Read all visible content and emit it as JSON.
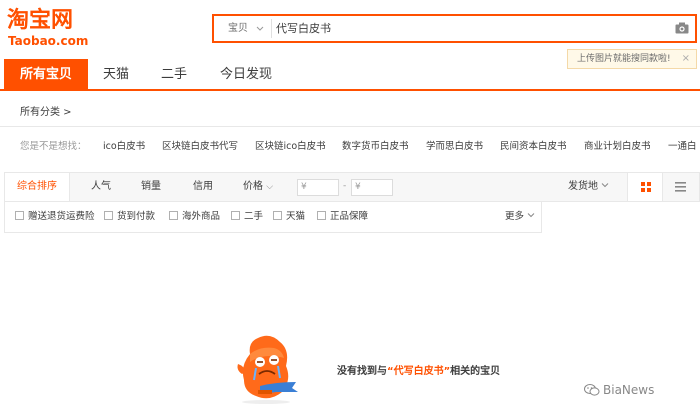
{
  "header": {
    "logo_cn": "淘宝网",
    "logo_en": "Taobao.com",
    "search": {
      "scope": "宝贝",
      "query": "代写白皮书"
    },
    "tip": "上传图片就能搜同款啦!",
    "tip_close": "×"
  },
  "nav": {
    "tabs": [
      {
        "label": "所有宝贝",
        "active": true
      },
      {
        "label": "天猫"
      },
      {
        "label": "二手"
      },
      {
        "label": "今日发现"
      }
    ]
  },
  "category": "所有分类 >",
  "suggest": {
    "label": "您是不是想找：",
    "items": [
      "ico白皮书",
      "区块链白皮书代写",
      "区块链ico白皮书",
      "数字货币白皮书",
      "学而思白皮书",
      "民间资本白皮书",
      "商业计划白皮书",
      "一通白"
    ]
  },
  "sort": {
    "items": [
      "综合排序",
      "人气",
      "销量",
      "信用",
      "价格"
    ],
    "price_chev": "⌵",
    "price_from": "¥",
    "price_dash": "-",
    "price_to": "¥",
    "ship_from": "发货地"
  },
  "filters": {
    "items": [
      "赠送退货运费险",
      "货到付款",
      "海外商品",
      "二手",
      "天猫",
      "正品保障"
    ],
    "more": "更多"
  },
  "empty": {
    "prefix": "没有找到与",
    "quote_open": "“",
    "query": "代写白皮书",
    "quote_close": "”",
    "suffix": "相关的宝贝"
  },
  "watermark": "BiaNews",
  "colors": {
    "brand": "#ff5000",
    "tip_bg": "#fff9e8"
  },
  "icons": [
    "camera-icon",
    "grid-view-icon",
    "list-view-icon",
    "chevron-down-icon",
    "close-icon",
    "wechat-icon"
  ]
}
